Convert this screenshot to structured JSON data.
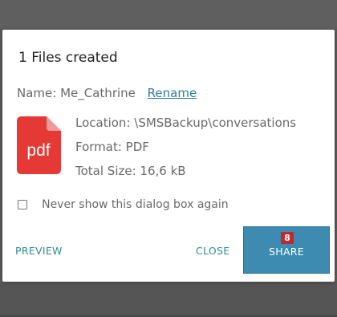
{
  "dialog": {
    "title": "1 Files created",
    "name_label": "Name:",
    "name_value": "Me_Cathrine",
    "rename_link": "Rename",
    "file_icon": {
      "icon": "pdf-file-icon",
      "label": "pdf",
      "color": "#e53935"
    },
    "location": "Location: \\SMSBackup\\conversations",
    "format": "Format: PDF",
    "total_size": "Total Size: 16,6 kB",
    "checkbox_label": "Never show this dialog box again",
    "checkbox_checked": false,
    "buttons": {
      "preview": "PREVIEW",
      "close": "CLOSE",
      "share": "SHARE",
      "share_badge": "8"
    }
  },
  "colors": {
    "accent": "#2f8e8a",
    "link": "#2b7f9b",
    "share_button": "#3d8bb0",
    "badge": "#c0282f"
  }
}
